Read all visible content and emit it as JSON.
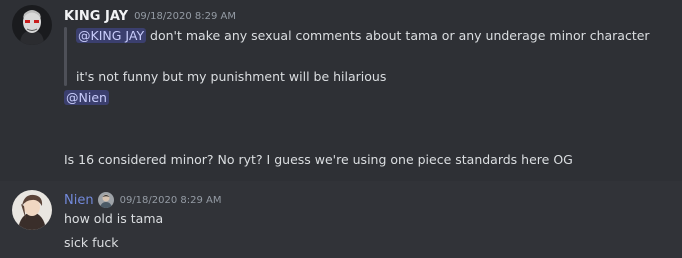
{
  "messages": [
    {
      "username": "KING JAY",
      "timestamp": "09/18/2020 8:29 AM",
      "quote": {
        "mention": "@KING JAY",
        "text1": " don't make any sexual comments about tama or any underage minor character",
        "text2": "it's not funny but my punishment will be hilarious"
      },
      "mention": "@Nien",
      "body": "Is 16 considered minor? No ryt? I guess we're using one piece standards here OG"
    },
    {
      "username": "Nien",
      "timestamp": "09/18/2020 8:29 AM",
      "lines": [
        "how old is tama",
        "sick fuck"
      ]
    }
  ],
  "colors": {
    "background": "#313338",
    "highlight_row": "#2e3035",
    "username_white": "#f2f3f5",
    "username_blue": "#7289da",
    "mention_bg": "#4a4f8a"
  }
}
